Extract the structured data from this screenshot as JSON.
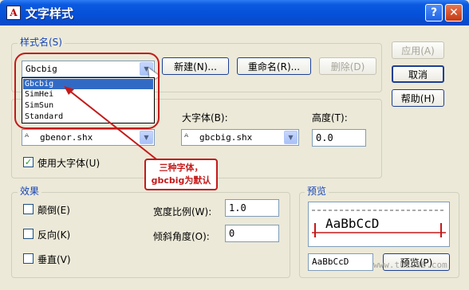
{
  "window": {
    "title": "文字样式",
    "help_glyph": "?",
    "close_glyph": "✕",
    "app_glyph": "A"
  },
  "style_group": {
    "title": "样式名(S)",
    "selected_value": "Gbcbig",
    "options": [
      "Gbcbig",
      "SimHei",
      "SimSun",
      "Standard"
    ],
    "new_button": "新建(N)...",
    "rename_button": "重命名(R)...",
    "delete_button": "删除(D)"
  },
  "right_buttons": {
    "apply": "应用(A)",
    "cancel": "取消",
    "help": "帮助(H)"
  },
  "font_group": {
    "font_combo_value": "gbenor.shx",
    "bigfont_label": "大字体(B):",
    "bigfont_value": "gbcbig.shx",
    "height_label": "高度(T):",
    "height_value": "0.0",
    "use_bigfont_label": "使用大字体(U)",
    "use_bigfont_checked": true
  },
  "effects_group": {
    "title": "效果",
    "upside_down": "颠倒(E)",
    "backwards": "反向(K)",
    "vertical": "垂直(V)",
    "width_factor_label": "宽度比例(W):",
    "width_factor_value": "1.0",
    "oblique_label": "倾斜角度(O):",
    "oblique_value": "0"
  },
  "preview_group": {
    "title": "预览",
    "sample_text": "AaBbCcD",
    "input_value": "AaBbCcD",
    "button": "预览(P)"
  },
  "annotation": {
    "line1": "三种字体，",
    "line2": "gbcbig为默认"
  },
  "watermark": "www.tu1u86.com",
  "colors": {
    "titlebar": "#0550d8",
    "annotation_red": "#c41a1a",
    "selection": "#316ac5"
  }
}
